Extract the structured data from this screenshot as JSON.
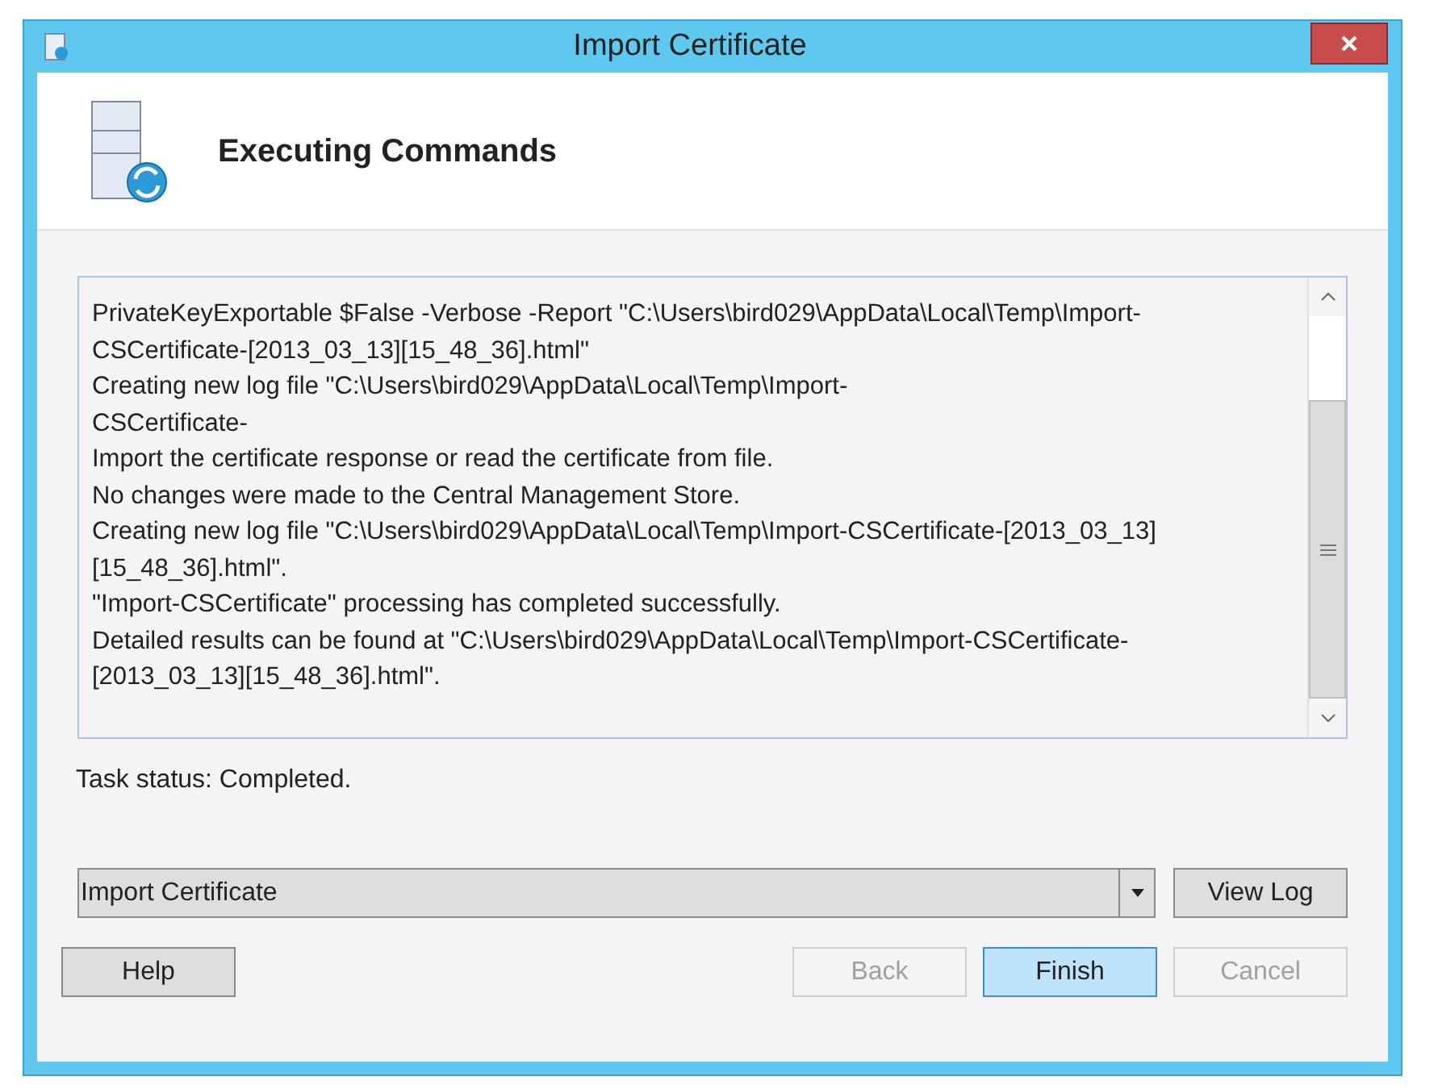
{
  "window": {
    "title": "Import Certificate"
  },
  "header": {
    "title": "Executing Commands"
  },
  "log": {
    "lines": [
      "PrivateKeyExportable $False -Verbose -Report \"C:\\Users\\bird029\\AppData\\Local\\Temp\\Import-",
      "CSCertificate-[2013_03_13][15_48_36].html\"",
      "Creating new log file \"C:\\Users\\bird029\\AppData\\Local\\Temp\\Import-",
      "CSCertificate-",
      "Import the certificate response or read the certificate from file.",
      "No changes were made to the Central Management Store.",
      "Creating new log file \"C:\\Users\\bird029\\AppData\\Local\\Temp\\Import-CSCertificate-[2013_03_13]",
      "[15_48_36].html\".",
      "\"Import-CSCertificate\" processing has completed successfully.",
      "Detailed results can be found at \"C:\\Users\\bird029\\AppData\\Local\\Temp\\Import-CSCertificate-",
      "[2013_03_13][15_48_36].html\"."
    ]
  },
  "task_status": "Task status: Completed.",
  "task_select": {
    "value": "Import Certificate"
  },
  "view_log_button": "View Log",
  "buttons": [
    {
      "label": "Help",
      "disabled": false,
      "highlighted": false
    },
    {
      "label": "Back",
      "disabled": true,
      "highlighted": false
    },
    {
      "label": "Finish",
      "disabled": false,
      "highlighted": true
    },
    {
      "label": "Cancel",
      "disabled": true,
      "highlighted": false
    }
  ]
}
